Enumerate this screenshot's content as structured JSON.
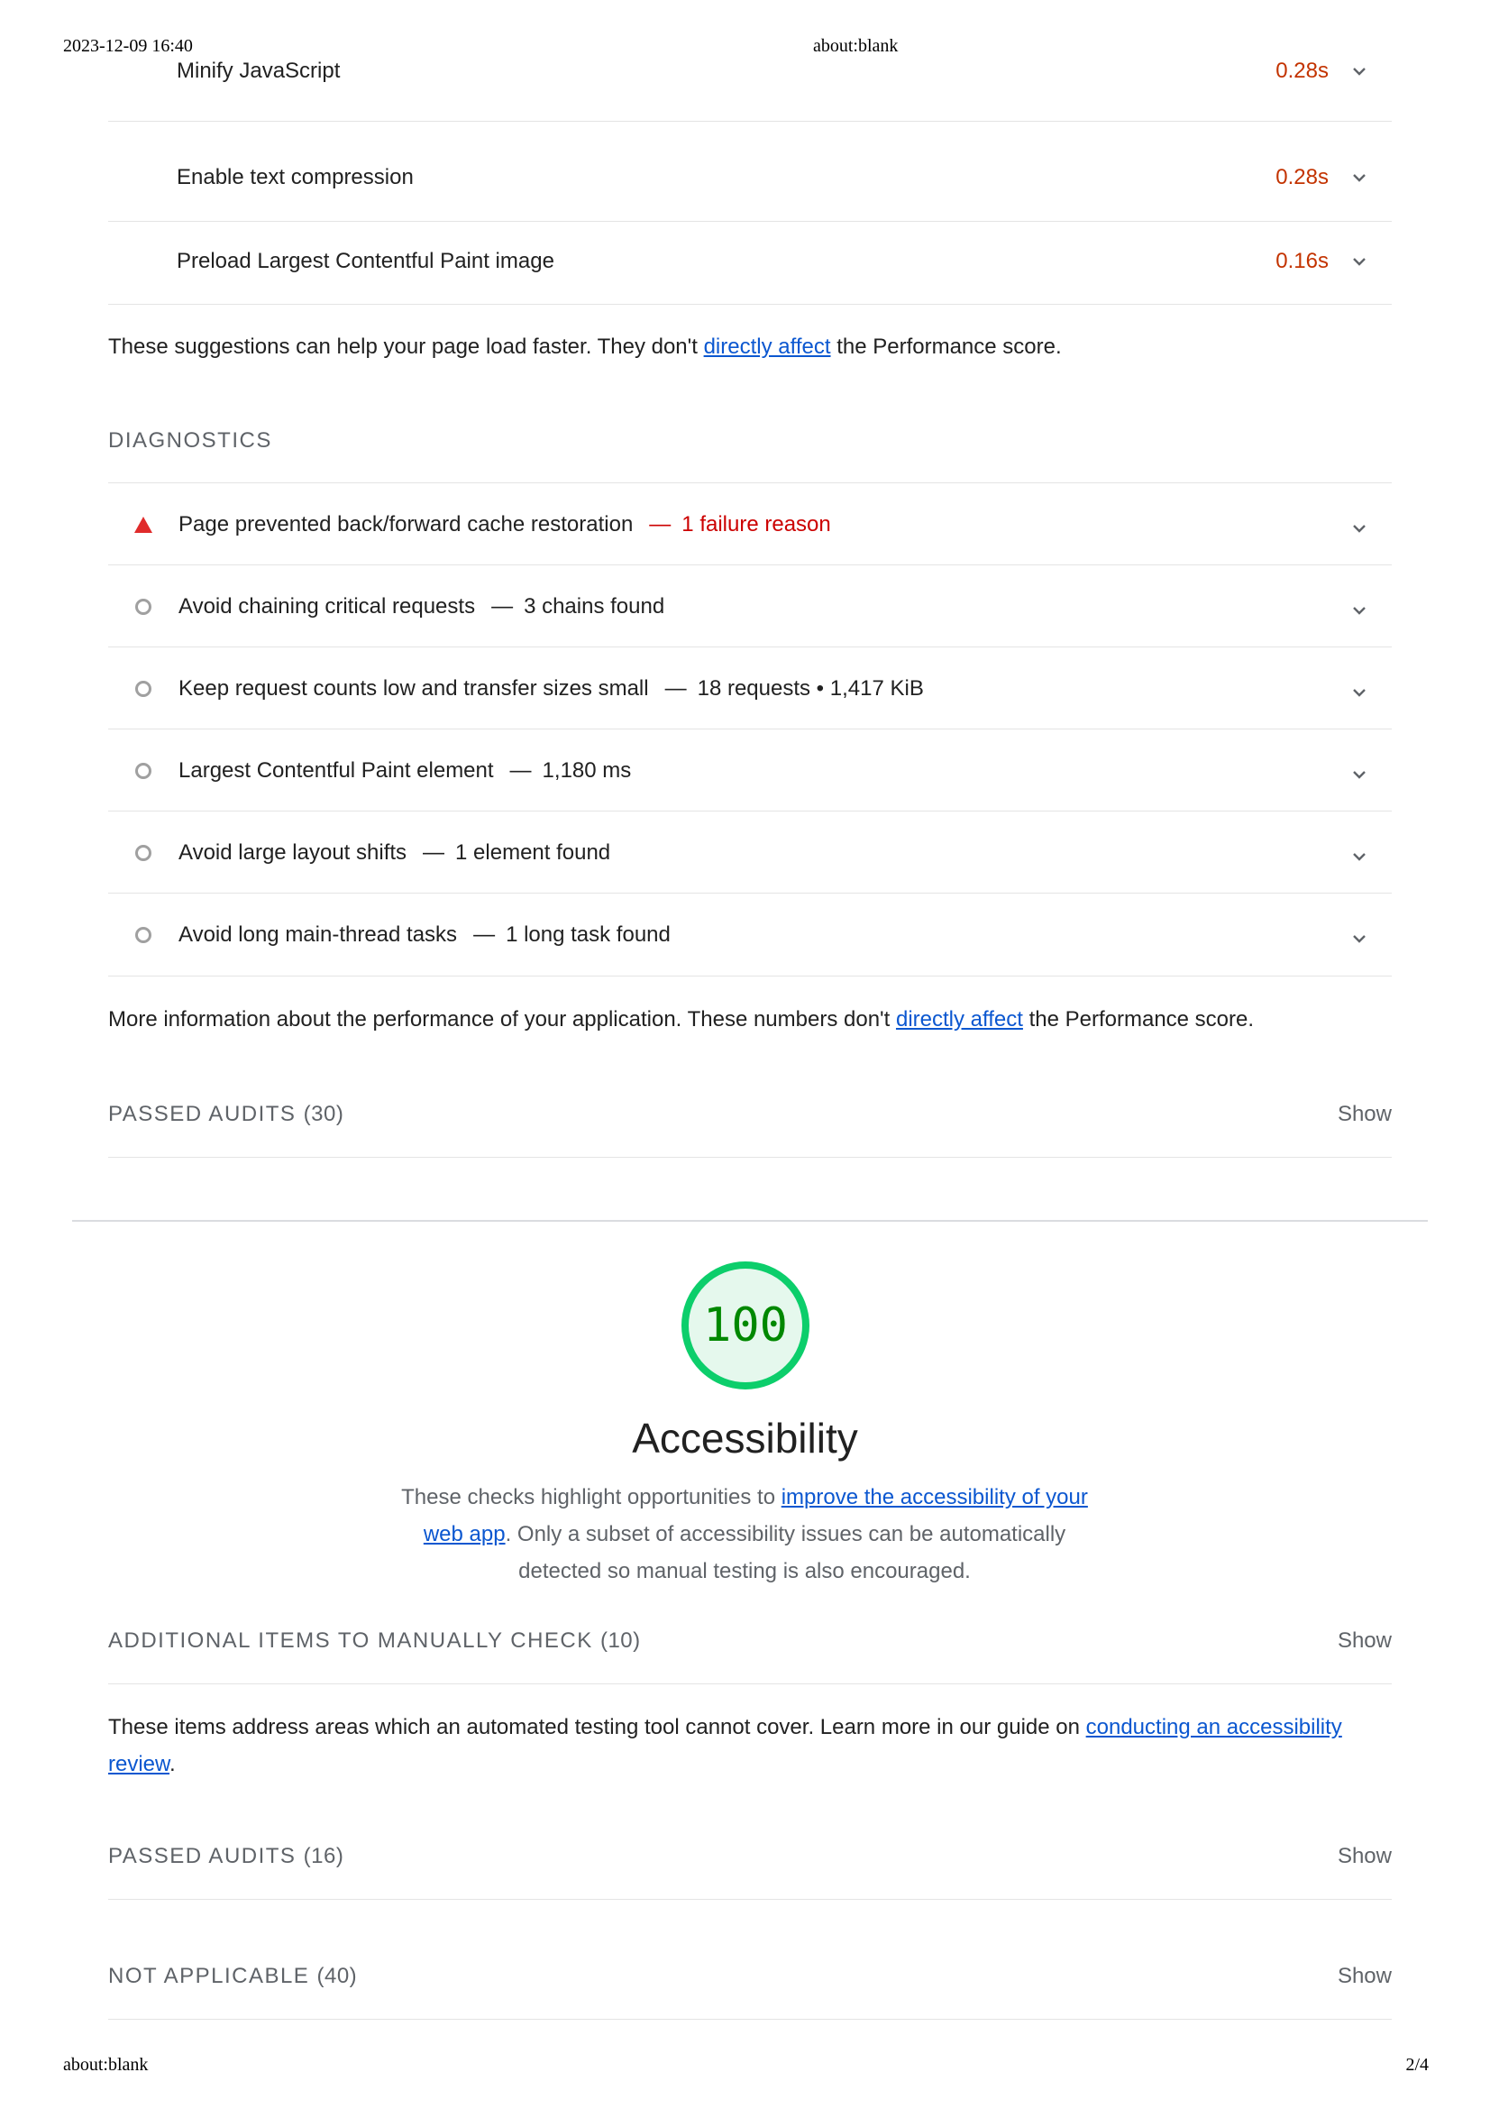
{
  "print": {
    "datetime": "2023-12-09 16:40",
    "header_url": "about:blank",
    "footer_url": "about:blank",
    "page": "2/4"
  },
  "opportunities": {
    "items": [
      {
        "title": "Minify JavaScript",
        "savings": "0.28s"
      },
      {
        "title": "Enable text compression",
        "savings": "0.28s"
      },
      {
        "title": "Preload Largest Contentful Paint image",
        "savings": "0.16s"
      }
    ],
    "note_before": "These suggestions can help your page load faster. They don't ",
    "note_link": "directly affect",
    "note_after": " the Performance score."
  },
  "diagnostics": {
    "title": "DIAGNOSTICS",
    "items": [
      {
        "title": "Page prevented back/forward cache restoration",
        "dash": "—",
        "detail": "1 failure reason",
        "status": "fail"
      },
      {
        "title": "Avoid chaining critical requests",
        "dash": "—",
        "detail": "3 chains found",
        "status": "info"
      },
      {
        "title": "Keep request counts low and transfer sizes small",
        "dash": "—",
        "detail": "18 requests • 1,417 KiB",
        "status": "info"
      },
      {
        "title": "Largest Contentful Paint element",
        "dash": "—",
        "detail": "1,180 ms",
        "status": "info"
      },
      {
        "title": "Avoid large layout shifts",
        "dash": "—",
        "detail": "1 element found",
        "status": "info"
      },
      {
        "title": "Avoid long main-thread tasks",
        "dash": "—",
        "detail": "1 long task found",
        "status": "info"
      }
    ],
    "note_before": "More information about the performance of your application. These numbers don't ",
    "note_link": "directly affect",
    "note_after": " the Performance score."
  },
  "perf_passed": {
    "label": "PASSED AUDITS",
    "count": "(30)",
    "show": "Show"
  },
  "accessibility": {
    "score": "100",
    "score_fraction": 1.0,
    "gauge_color": "#0cce6b",
    "gauge_fill": "#e5f8ed",
    "title": "Accessibility",
    "desc_before": "These checks highlight opportunities to ",
    "desc_link": "improve the accessibility of your web app",
    "desc_after": ". Only a subset of accessibility issues can be automatically detected so manual testing is also encouraged.",
    "manual": {
      "label": "ADDITIONAL ITEMS TO MANUALLY CHECK",
      "count": "(10)",
      "show": "Show"
    },
    "manual_note_before": "These items address areas which an automated testing tool cannot cover. Learn more in our guide on ",
    "manual_note_link": "conducting an accessibility review",
    "manual_note_after": ".",
    "passed": {
      "label": "PASSED AUDITS",
      "count": "(16)",
      "show": "Show"
    },
    "not_applicable": {
      "label": "NOT APPLICABLE",
      "count": "(40)",
      "show": "Show"
    }
  },
  "colors": {
    "savings": "#c33300",
    "fail": "#cc0000",
    "link": "#0b57d0",
    "pass": "#0cce6b"
  },
  "icons": {
    "fail": "red-triangle-icon",
    "info": "gray-circle-icon",
    "expand": "chevron-down-icon"
  }
}
